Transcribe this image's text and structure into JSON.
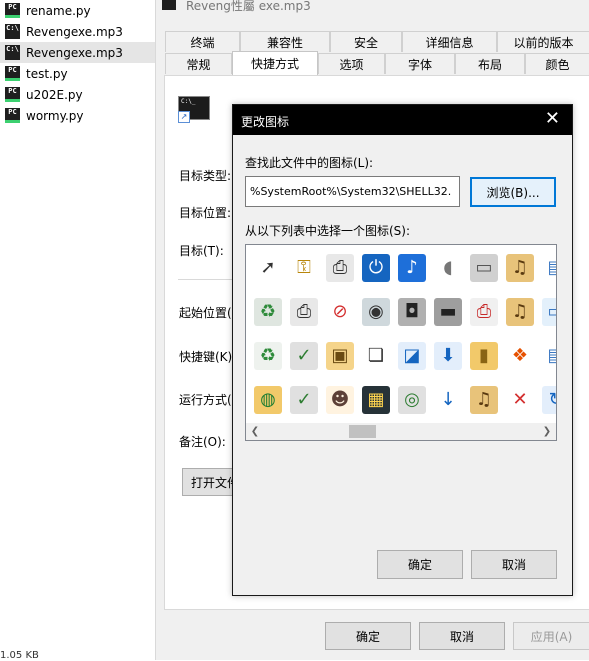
{
  "explorer": {
    "files": [
      {
        "name": "rename.py",
        "icon": "pycharm-file-icon",
        "badge": "PC"
      },
      {
        "name": "Revengexe.mp3",
        "icon": "console-shortcut-icon",
        "badge": "C:\\"
      },
      {
        "name": "Revengexe.mp3",
        "icon": "console-shortcut-icon",
        "badge": "C:\\",
        "selected": true
      },
      {
        "name": "test.py",
        "icon": "pycharm-file-icon",
        "badge": "PC"
      },
      {
        "name": "u202E.py",
        "icon": "pycharm-file-icon",
        "badge": "PC"
      },
      {
        "name": "wormy.py",
        "icon": "pycharm-file-icon",
        "badge": "PC"
      }
    ],
    "size_text": "1.05 KB"
  },
  "properties": {
    "title": "Reveng性屬 exe.mp3",
    "tabs_row1": [
      "终端",
      "兼容性",
      "安全",
      "详细信息",
      "以前的版本"
    ],
    "tabs_row2": [
      "常规",
      "快捷方式",
      "选项",
      "字体",
      "布局",
      "颜色"
    ],
    "active_tab": "快捷方式",
    "labels": {
      "target_type": "目标类型:",
      "target_location": "目标位置:",
      "target": "目标(T):",
      "start_in": "起始位置(S",
      "shortcut_key": "快捷键(K):",
      "run": "运行方式(",
      "comment": "备注(O):"
    },
    "open_location_button": "打开文件",
    "buttons": {
      "ok": "确定",
      "cancel": "取消",
      "apply": "应用(A)"
    }
  },
  "dialog": {
    "title": "更改图标",
    "find_label": "查找此文件中的图标(L):",
    "file_path": "%SystemRoot%\\System32\\SHELL32.",
    "browse_button": "浏览(B)...",
    "select_label": "从以下列表中选择一个图标(S):",
    "ok_button": "确定",
    "cancel_button": "取消",
    "icons": [
      [
        "cursor-click-icon",
        "keys-icon",
        "printer-icon",
        "power-icon",
        "music-note-icon",
        "mouse-icon",
        "drive-icon",
        "music-folder-icon",
        "document-icon"
      ],
      [
        "recycle-bin-full-icon",
        "printer-icon",
        "prohibited-icon",
        "dvd-icon",
        "camera-icon",
        "hard-drive-icon",
        "printer-error-icon",
        "music-folder-icon",
        "window-icon"
      ],
      [
        "recycle-bin-empty-icon",
        "printer-check-icon",
        "folder-notes-icon",
        "documents-icon",
        "web-page-icon",
        "download-arrow-icon",
        "folder-icon",
        "windows-logo-icon",
        "document-icon"
      ],
      [
        "network-folder-icon",
        "printer-check-icon",
        "user-key-icon",
        "film-icon",
        "cd-network-icon",
        "download-small-icon",
        "music-folder-icon",
        "delete-x-icon",
        "globe-arrow-icon"
      ]
    ]
  }
}
